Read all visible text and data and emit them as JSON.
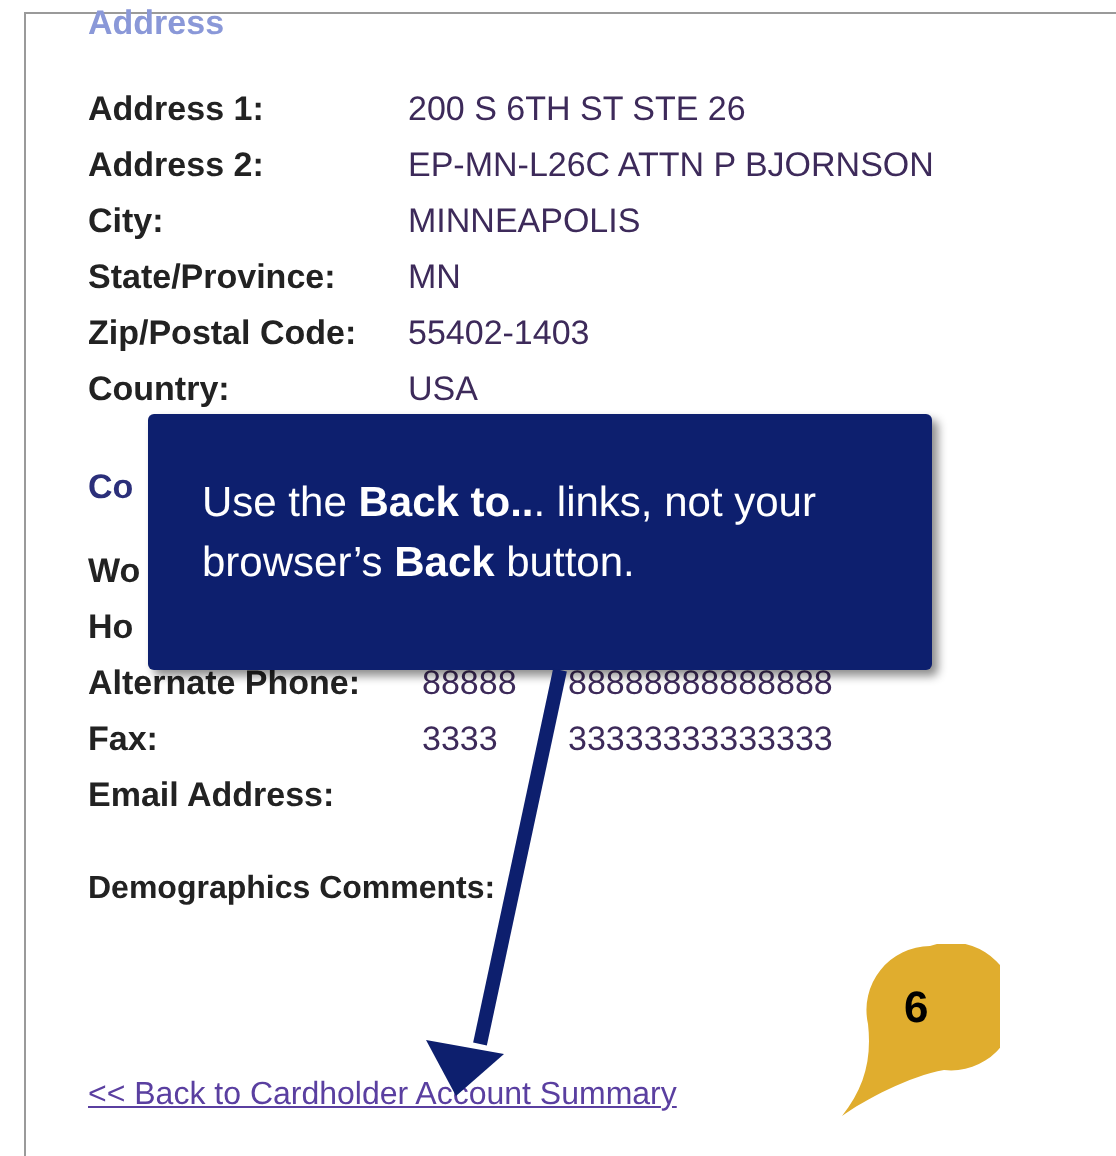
{
  "section_heading": "Address",
  "address_fields": [
    {
      "label": "Address 1:",
      "value": "200 S 6TH ST STE 26"
    },
    {
      "label": "Address 2:",
      "value": "EP-MN-L26C ATTN P BJORNSON"
    },
    {
      "label": "City:",
      "value": "MINNEAPOLIS"
    },
    {
      "label": "State/Province:",
      "value": "MN"
    },
    {
      "label": "Zip/Postal Code:",
      "value": "55402-1403"
    },
    {
      "label": "Country:",
      "value": "USA"
    }
  ],
  "contact_heading": "Co",
  "contact_fields": [
    {
      "label": "Wo"
    },
    {
      "label": "Ho"
    },
    {
      "label": "Alternate Phone:",
      "value_parts": [
        "88888",
        "88888888888888"
      ]
    },
    {
      "label": "Fax:",
      "value_parts": [
        "3333",
        "33333333333333"
      ]
    },
    {
      "label": "Email Address:"
    }
  ],
  "comments_label": "Demographics Comments:",
  "back_link": "<< Back to Cardholder Account Summary",
  "callout": {
    "text": "Use the **Back to..**. links, not your browser’s **Back** button."
  },
  "step_badge": "6"
}
